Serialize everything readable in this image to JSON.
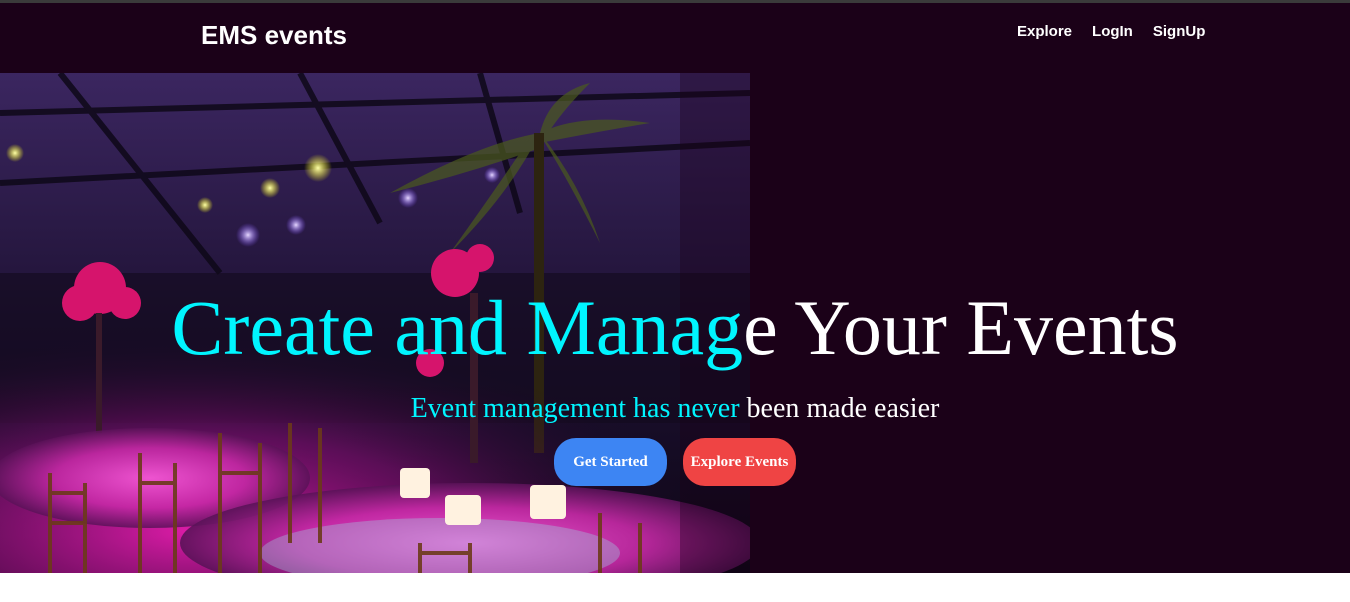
{
  "navbar": {
    "brand": "EMS events",
    "links": [
      "Explore",
      "LogIn",
      "SignUp"
    ]
  },
  "hero": {
    "title_part1": "Create and Manag",
    "title_part2": "e Your Events",
    "subtitle_part1": "Event management has never ",
    "subtitle_part2": "been made easier",
    "primary_button": "Get Started",
    "secondary_button": "Explore Events"
  },
  "colors": {
    "background": "#1b0118",
    "accent_cyan": "#00f5ff",
    "primary_button": "#3d85f3",
    "secondary_button": "#ef4444"
  }
}
